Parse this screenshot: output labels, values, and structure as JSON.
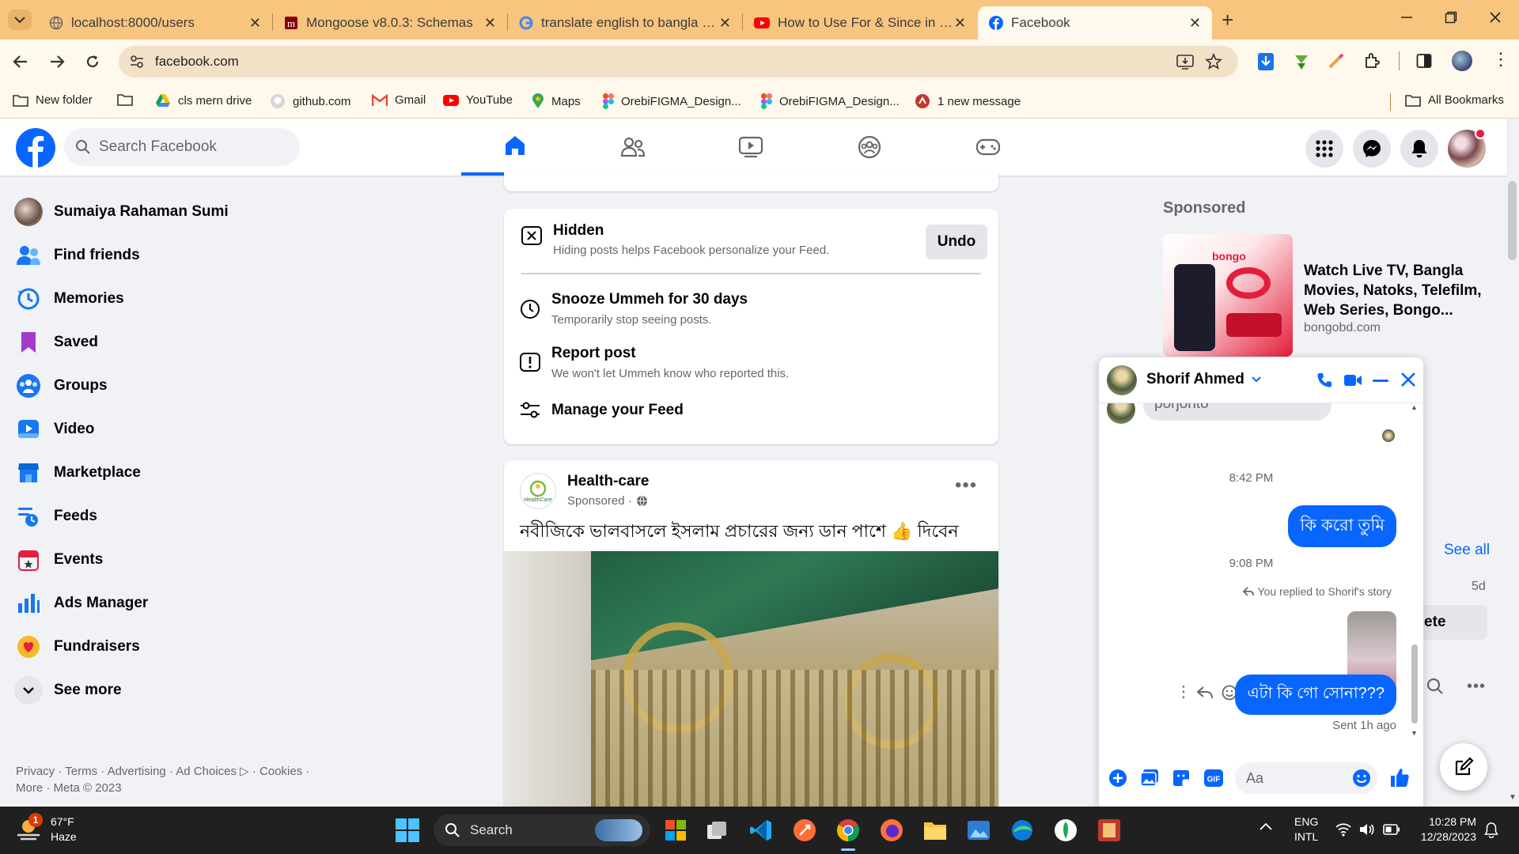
{
  "browser": {
    "tabs": [
      {
        "title": "localhost:8000/users",
        "icon": "globe-icon"
      },
      {
        "title": "Mongoose v8.0.3: Schemas",
        "icon": "mongoose-icon"
      },
      {
        "title": "translate english to bangla - Go",
        "icon": "google-icon"
      },
      {
        "title": "How to Use For & Since in Pres",
        "icon": "youtube-icon"
      },
      {
        "title": "Facebook",
        "icon": "facebook-icon"
      }
    ],
    "url": "facebook.com",
    "bookmarks": [
      {
        "label": "New folder",
        "icon": "folder-icon"
      },
      {
        "label": "",
        "icon": "folder-icon"
      },
      {
        "label": "cls mern drive",
        "icon": "drive-icon"
      },
      {
        "label": "github.com",
        "icon": "github-icon"
      },
      {
        "label": "Gmail",
        "icon": "gmail-icon"
      },
      {
        "label": "YouTube",
        "icon": "youtube-icon"
      },
      {
        "label": "Maps",
        "icon": "maps-icon"
      },
      {
        "label": "OrebiFIGMA_Design...",
        "icon": "figma-icon"
      },
      {
        "label": "OrebiFIGMA_Design...",
        "icon": "figma-icon"
      },
      {
        "label": "1 new message",
        "icon": "message-icon"
      }
    ],
    "all_bookmarks": "All Bookmarks"
  },
  "header": {
    "search_placeholder": "Search Facebook"
  },
  "sidebar": {
    "items": [
      {
        "label": "Sumaiya Rahaman Sumi",
        "icon": "avatar"
      },
      {
        "label": "Find friends",
        "icon": "friends-icon"
      },
      {
        "label": "Memories",
        "icon": "memories-icon"
      },
      {
        "label": "Saved",
        "icon": "bookmark-icon"
      },
      {
        "label": "Groups",
        "icon": "groups-icon"
      },
      {
        "label": "Video",
        "icon": "video-icon"
      },
      {
        "label": "Marketplace",
        "icon": "marketplace-icon"
      },
      {
        "label": "Feeds",
        "icon": "feeds-icon"
      },
      {
        "label": "Events",
        "icon": "events-icon"
      },
      {
        "label": "Ads Manager",
        "icon": "ads-manager-icon"
      },
      {
        "label": "Fundraisers",
        "icon": "fundraisers-icon"
      },
      {
        "label": "See more",
        "icon": "chevron-down-icon"
      }
    ],
    "footer_line1": "Privacy · Terms · Advertising · Ad Choices ▷ · Cookies ·",
    "footer_line2": "More · Meta © 2023"
  },
  "hidden_card": {
    "title": "Hidden",
    "subtitle": "Hiding posts helps Facebook personalize your Feed.",
    "undo": "Undo",
    "options": [
      {
        "title": "Snooze Ummeh for 30 days",
        "sub": "Temporarily stop seeing posts.",
        "icon": "clock-icon"
      },
      {
        "title": "Report post",
        "sub": "We won't let Ummeh know who reported this.",
        "icon": "report-icon"
      },
      {
        "title": "Manage your Feed",
        "sub": "",
        "icon": "sliders-icon"
      }
    ]
  },
  "post": {
    "author": "Health-care",
    "meta": "Sponsored ·",
    "text": "নবীজিকে ভালবাসলে ইসলাম প্রচারের জন্য ডান পাশে 👍 দিবেন",
    "logo_text": "HealthCare"
  },
  "right": {
    "sponsored": "Sponsored",
    "ad_title": "Watch Live TV, Bangla Movies, Natoks, Telefilm, Web Series, Bongo...",
    "ad_domain": "bongobd.com",
    "ad_image_text": "bongo",
    "see_all": "See all",
    "days": "5d",
    "partial_button": "ete"
  },
  "chat": {
    "name": "Shorif Ahmed",
    "partial_msg": "porjonto",
    "time1": "8:42 PM",
    "msg1": "কি করো তুমি",
    "time2": "9:08 PM",
    "reply_note": "You replied to Shorif's story",
    "msg2": "এটা কি গো সোনা???",
    "sent": "Sent 1h ago",
    "input_placeholder": "Aa"
  },
  "taskbar": {
    "temp": "67°F",
    "weather": "Haze",
    "badge": "1",
    "search": "Search",
    "lang1": "ENG",
    "lang2": "INTL",
    "time": "10:28 PM",
    "date": "12/28/2023"
  },
  "colors": {
    "fb_blue": "#0866ff",
    "tabbar": "#f7c57e",
    "toolbar": "#fff8ec"
  }
}
